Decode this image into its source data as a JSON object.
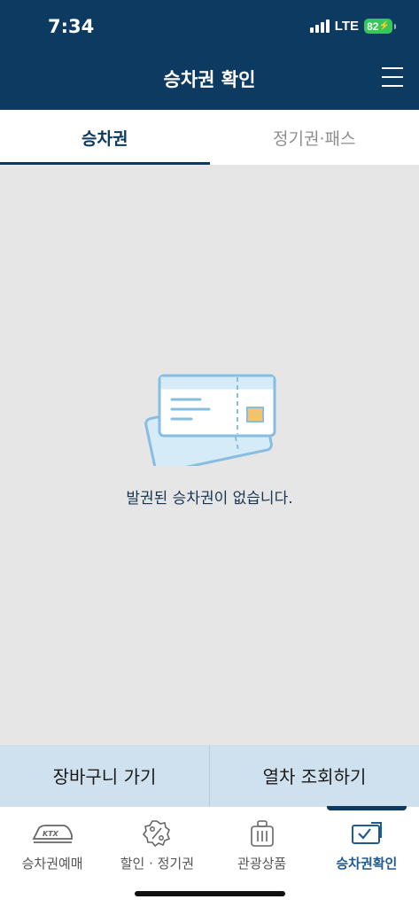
{
  "status_bar": {
    "time": "7:34",
    "network": "LTE",
    "battery": "82"
  },
  "header": {
    "title": "승차권 확인"
  },
  "tabs": [
    {
      "label": "승차권",
      "active": true
    },
    {
      "label": "정기권·패스",
      "active": false
    }
  ],
  "empty_state": {
    "message": "발권된 승차권이 없습니다."
  },
  "actions": {
    "cart": "장바구니 가기",
    "train_search": "열차 조회하기"
  },
  "bottom_nav": [
    {
      "label": "승차권예매",
      "icon": "ktx-train-icon"
    },
    {
      "label": "할인 · 정기권",
      "icon": "discount-percent-icon"
    },
    {
      "label": "관광상품",
      "icon": "suitcase-icon"
    },
    {
      "label": "승차권확인",
      "icon": "ticket-check-icon",
      "active": true
    }
  ],
  "ktx_logo_text": "KTX",
  "colors": {
    "primary": "#0c3a60",
    "accent": "#1c5a91",
    "action_bar": "#cfe1ee",
    "background": "#e6e6e6",
    "battery": "#34c759"
  }
}
